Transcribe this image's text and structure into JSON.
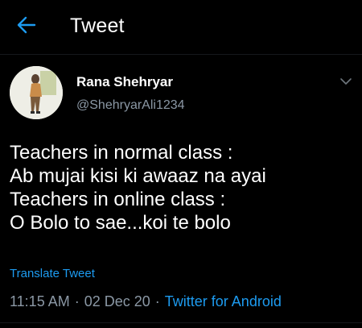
{
  "colors": {
    "background": "#000000",
    "text_primary": "#ffffff",
    "text_secondary": "#8b98a5",
    "accent": "#1d9bf0"
  },
  "header": {
    "back_icon": "arrow-left-icon",
    "title": "Tweet"
  },
  "user": {
    "avatar_icon": "profile-photo",
    "name": "Rana Shehryar",
    "handle": "@ShehryarAli1234",
    "more_icon": "chevron-down-icon"
  },
  "tweet": {
    "lines": [
      "Teachers in normal class :",
      "Ab mujai kisi ki awaaz na ayai",
      "Teachers in online class :",
      "O Bolo to sae...koi te bolo"
    ],
    "translate_label": "Translate Tweet",
    "time": "11:15 AM",
    "date": "02 Dec 20",
    "separator": "·",
    "source": "Twitter for Android"
  }
}
